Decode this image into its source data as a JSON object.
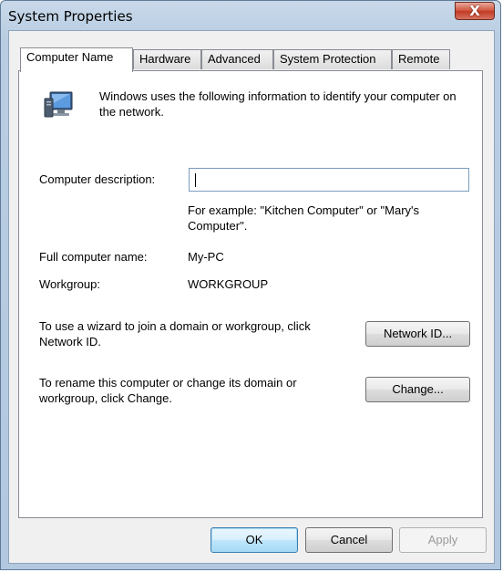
{
  "window": {
    "title": "System Properties",
    "close_glyph": "X"
  },
  "tabs": [
    {
      "label": "Computer Name",
      "active": true
    },
    {
      "label": "Hardware",
      "active": false
    },
    {
      "label": "Advanced",
      "active": false
    },
    {
      "label": "System Protection",
      "active": false
    },
    {
      "label": "Remote",
      "active": false
    }
  ],
  "computer_name": {
    "info_text": "Windows uses the following information to identify your computer on the network.",
    "info_icon": "computer-network-icon",
    "description_label": "Computer description:",
    "description_value": "",
    "example_text": "For example: \"Kitchen Computer\" or \"Mary's Computer\".",
    "full_name_label": "Full computer name:",
    "full_name_value": "My-PC",
    "workgroup_label": "Workgroup:",
    "workgroup_value": "WORKGROUP",
    "network_id_text": "To use a wizard to join a domain or workgroup, click Network ID.",
    "network_id_button": "Network ID...",
    "change_text": "To rename this computer or change its domain or workgroup, click Change.",
    "change_button": "Change..."
  },
  "footer": {
    "ok": "OK",
    "cancel": "Cancel",
    "apply": "Apply"
  }
}
